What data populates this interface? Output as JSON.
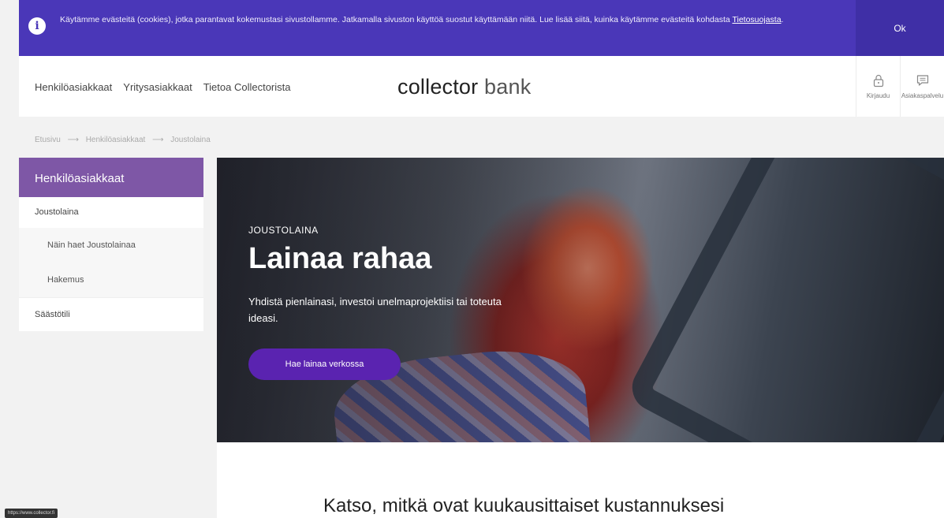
{
  "cookie": {
    "message": "Käytämme evästeitä (cookies), jotka parantavat kokemustasi sivustollamme. Jatkamalla sivuston käyttöä suostut käyttämään niitä. Lue lisää siitä, kuinka käytämme evästeitä kohdasta",
    "link": "Tietosuojasta",
    "ok_label": "Ok",
    "accent": "#4a37b8"
  },
  "header": {
    "nav": [
      "Henkilöasiakkaat",
      "Yritysasiakkaat",
      "Tietoa Collectorista"
    ],
    "logo_main": "collector",
    "logo_sub": "bank",
    "login_label": "Kirjaudu",
    "login_icon": "lock-icon",
    "service_label": "Asiakaspalvelu",
    "service_icon": "chat-icon"
  },
  "breadcrumb": [
    "Etusivu",
    "Henkilöasiakkaat",
    "Joustolaina"
  ],
  "sidebar": {
    "title": "Henkilöasiakkaat",
    "items": [
      {
        "label": "Joustolaina"
      },
      {
        "label": "Näin haet Joustolainaa"
      },
      {
        "label": "Hakemus"
      },
      {
        "label": "Säästötili"
      }
    ],
    "color": "#7e57a6"
  },
  "hero": {
    "eyebrow": "JOUSTOLAINA",
    "title": "Lainaa rahaa",
    "subtitle": "Yhdistä pienlainasi, investoi unelmaprojektiisi tai toteuta ideasi.",
    "cta": "Hae lainaa verkossa",
    "cta_color": "#5a23b0"
  },
  "section": {
    "heading": "Katso, mitkä ovat kuukausittaiset kustannuksesi"
  },
  "status_url": "https://www.collector.fi"
}
